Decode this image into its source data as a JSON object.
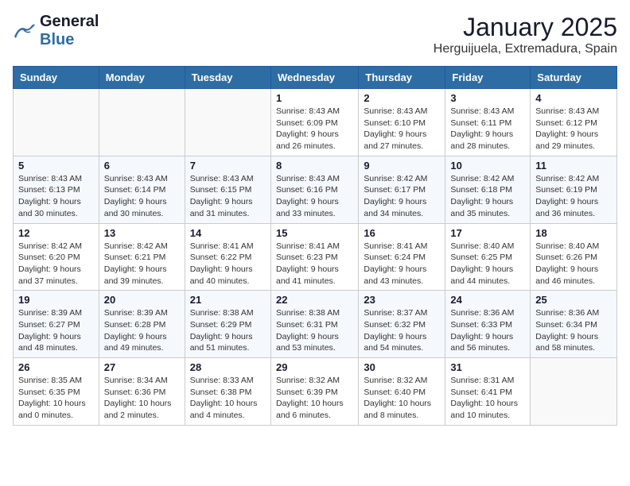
{
  "header": {
    "logo_general": "General",
    "logo_blue": "Blue",
    "month_title": "January 2025",
    "location": "Herguijuela, Extremadura, Spain"
  },
  "weekdays": [
    "Sunday",
    "Monday",
    "Tuesday",
    "Wednesday",
    "Thursday",
    "Friday",
    "Saturday"
  ],
  "weeks": [
    [
      {
        "day": "",
        "info": ""
      },
      {
        "day": "",
        "info": ""
      },
      {
        "day": "",
        "info": ""
      },
      {
        "day": "1",
        "info": "Sunrise: 8:43 AM\nSunset: 6:09 PM\nDaylight: 9 hours and 26 minutes."
      },
      {
        "day": "2",
        "info": "Sunrise: 8:43 AM\nSunset: 6:10 PM\nDaylight: 9 hours and 27 minutes."
      },
      {
        "day": "3",
        "info": "Sunrise: 8:43 AM\nSunset: 6:11 PM\nDaylight: 9 hours and 28 minutes."
      },
      {
        "day": "4",
        "info": "Sunrise: 8:43 AM\nSunset: 6:12 PM\nDaylight: 9 hours and 29 minutes."
      }
    ],
    [
      {
        "day": "5",
        "info": "Sunrise: 8:43 AM\nSunset: 6:13 PM\nDaylight: 9 hours and 30 minutes."
      },
      {
        "day": "6",
        "info": "Sunrise: 8:43 AM\nSunset: 6:14 PM\nDaylight: 9 hours and 30 minutes."
      },
      {
        "day": "7",
        "info": "Sunrise: 8:43 AM\nSunset: 6:15 PM\nDaylight: 9 hours and 31 minutes."
      },
      {
        "day": "8",
        "info": "Sunrise: 8:43 AM\nSunset: 6:16 PM\nDaylight: 9 hours and 33 minutes."
      },
      {
        "day": "9",
        "info": "Sunrise: 8:42 AM\nSunset: 6:17 PM\nDaylight: 9 hours and 34 minutes."
      },
      {
        "day": "10",
        "info": "Sunrise: 8:42 AM\nSunset: 6:18 PM\nDaylight: 9 hours and 35 minutes."
      },
      {
        "day": "11",
        "info": "Sunrise: 8:42 AM\nSunset: 6:19 PM\nDaylight: 9 hours and 36 minutes."
      }
    ],
    [
      {
        "day": "12",
        "info": "Sunrise: 8:42 AM\nSunset: 6:20 PM\nDaylight: 9 hours and 37 minutes."
      },
      {
        "day": "13",
        "info": "Sunrise: 8:42 AM\nSunset: 6:21 PM\nDaylight: 9 hours and 39 minutes."
      },
      {
        "day": "14",
        "info": "Sunrise: 8:41 AM\nSunset: 6:22 PM\nDaylight: 9 hours and 40 minutes."
      },
      {
        "day": "15",
        "info": "Sunrise: 8:41 AM\nSunset: 6:23 PM\nDaylight: 9 hours and 41 minutes."
      },
      {
        "day": "16",
        "info": "Sunrise: 8:41 AM\nSunset: 6:24 PM\nDaylight: 9 hours and 43 minutes."
      },
      {
        "day": "17",
        "info": "Sunrise: 8:40 AM\nSunset: 6:25 PM\nDaylight: 9 hours and 44 minutes."
      },
      {
        "day": "18",
        "info": "Sunrise: 8:40 AM\nSunset: 6:26 PM\nDaylight: 9 hours and 46 minutes."
      }
    ],
    [
      {
        "day": "19",
        "info": "Sunrise: 8:39 AM\nSunset: 6:27 PM\nDaylight: 9 hours and 48 minutes."
      },
      {
        "day": "20",
        "info": "Sunrise: 8:39 AM\nSunset: 6:28 PM\nDaylight: 9 hours and 49 minutes."
      },
      {
        "day": "21",
        "info": "Sunrise: 8:38 AM\nSunset: 6:29 PM\nDaylight: 9 hours and 51 minutes."
      },
      {
        "day": "22",
        "info": "Sunrise: 8:38 AM\nSunset: 6:31 PM\nDaylight: 9 hours and 53 minutes."
      },
      {
        "day": "23",
        "info": "Sunrise: 8:37 AM\nSunset: 6:32 PM\nDaylight: 9 hours and 54 minutes."
      },
      {
        "day": "24",
        "info": "Sunrise: 8:36 AM\nSunset: 6:33 PM\nDaylight: 9 hours and 56 minutes."
      },
      {
        "day": "25",
        "info": "Sunrise: 8:36 AM\nSunset: 6:34 PM\nDaylight: 9 hours and 58 minutes."
      }
    ],
    [
      {
        "day": "26",
        "info": "Sunrise: 8:35 AM\nSunset: 6:35 PM\nDaylight: 10 hours and 0 minutes."
      },
      {
        "day": "27",
        "info": "Sunrise: 8:34 AM\nSunset: 6:36 PM\nDaylight: 10 hours and 2 minutes."
      },
      {
        "day": "28",
        "info": "Sunrise: 8:33 AM\nSunset: 6:38 PM\nDaylight: 10 hours and 4 minutes."
      },
      {
        "day": "29",
        "info": "Sunrise: 8:32 AM\nSunset: 6:39 PM\nDaylight: 10 hours and 6 minutes."
      },
      {
        "day": "30",
        "info": "Sunrise: 8:32 AM\nSunset: 6:40 PM\nDaylight: 10 hours and 8 minutes."
      },
      {
        "day": "31",
        "info": "Sunrise: 8:31 AM\nSunset: 6:41 PM\nDaylight: 10 hours and 10 minutes."
      },
      {
        "day": "",
        "info": ""
      }
    ]
  ]
}
